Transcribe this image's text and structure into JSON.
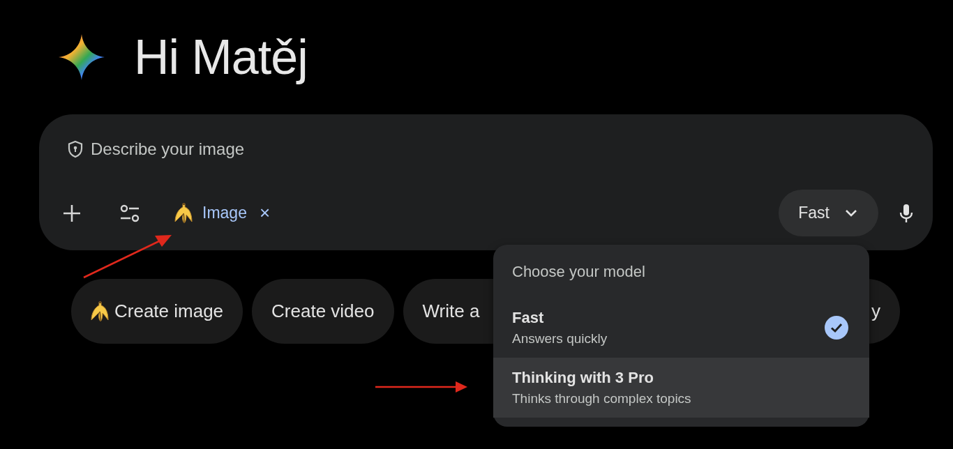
{
  "greeting": {
    "text": "Hi Matěj"
  },
  "prompt": {
    "placeholder": "Describe your image",
    "tool": {
      "label": "Image",
      "remove": "×"
    },
    "model_button": {
      "label": "Fast",
      "expanded": true
    }
  },
  "suggestions": [
    {
      "label": "Create image",
      "kind": "with-icon"
    },
    {
      "label": "Create video",
      "kind": "plain"
    },
    {
      "label": "Write a",
      "kind": "plain"
    },
    {
      "label": "y",
      "kind": "end"
    }
  ],
  "model_menu": {
    "title": "Choose your model",
    "options": [
      {
        "name": "Fast",
        "description": "Answers quickly",
        "selected": true,
        "hovered": false
      },
      {
        "name": "Thinking with 3 Pro",
        "description": "Thinks through complex topics",
        "selected": false,
        "hovered": true
      }
    ]
  }
}
